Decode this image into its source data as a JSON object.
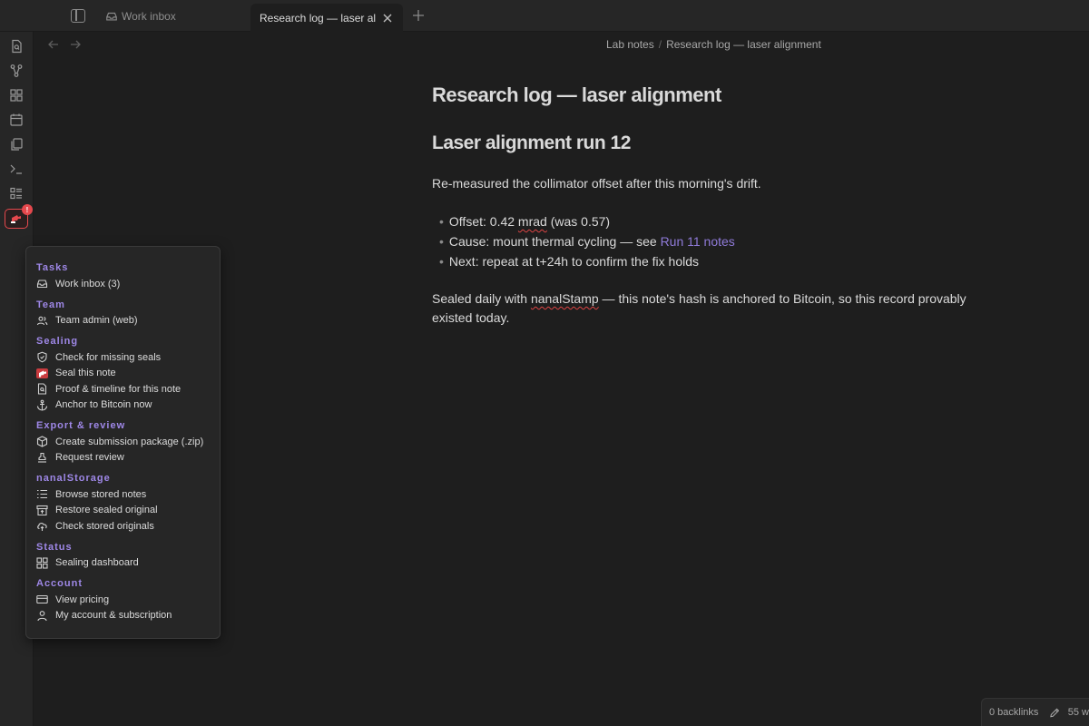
{
  "tabs": {
    "inactive": {
      "icon": "inbox-icon",
      "label": "Work inbox"
    },
    "active": {
      "label": "Research log — laser alig…"
    }
  },
  "breadcrumb": {
    "folder": "Lab notes",
    "separator": "/",
    "note": "Research log — laser alignment"
  },
  "note": {
    "title": "Research log — laser alignment",
    "heading": "Laser alignment run 12",
    "intro": "Re-measured the collimator offset after this morning's drift.",
    "bullets": {
      "offset_prefix": "Offset: 0.42 ",
      "offset_unit": "mrad",
      "offset_suffix": " (was 0.57)",
      "cause_prefix": "Cause: mount thermal cycling — see ",
      "cause_link": "Run 11 notes",
      "next": "Next: repeat at t+24h to confirm the fix holds"
    },
    "seal_prefix": "Sealed daily with ",
    "seal_name": "nanalStamp",
    "seal_suffix": " — this note's hash is anchored to Bitcoin, so this record provably existed today."
  },
  "ribbon": {
    "badge": "!",
    "icons": [
      "file-search-icon",
      "graph-icon",
      "grid-icon",
      "calendar-icon",
      "copy-icon",
      "terminal-icon",
      "list-icon",
      "stamp-icon"
    ]
  },
  "menu": {
    "tasks": {
      "title": "Tasks",
      "items": [
        "Work inbox (3)"
      ]
    },
    "team": {
      "title": "Team",
      "items": [
        "Team admin (web)"
      ]
    },
    "sealing": {
      "title": "Sealing",
      "items": [
        "Check for missing seals",
        "Seal this note",
        "Proof & timeline for this note",
        "Anchor to Bitcoin now"
      ]
    },
    "export": {
      "title": "Export & review",
      "items": [
        "Create submission package (.zip)",
        "Request review"
      ]
    },
    "storage": {
      "title": "nanalStorage",
      "items": [
        "Browse stored notes",
        "Restore sealed original",
        "Check stored originals"
      ]
    },
    "status": {
      "title": "Status",
      "items": [
        "Sealing dashboard"
      ]
    },
    "account": {
      "title": "Account",
      "items": [
        "View pricing",
        "My account & subscription"
      ]
    }
  },
  "statusbar": {
    "backlinks": "0 backlinks",
    "words": "55 w"
  },
  "colors": {
    "accent": "#9f88e8",
    "link": "#8f7ad8",
    "alert": "#e5484d",
    "background": "#1e1e1e"
  }
}
